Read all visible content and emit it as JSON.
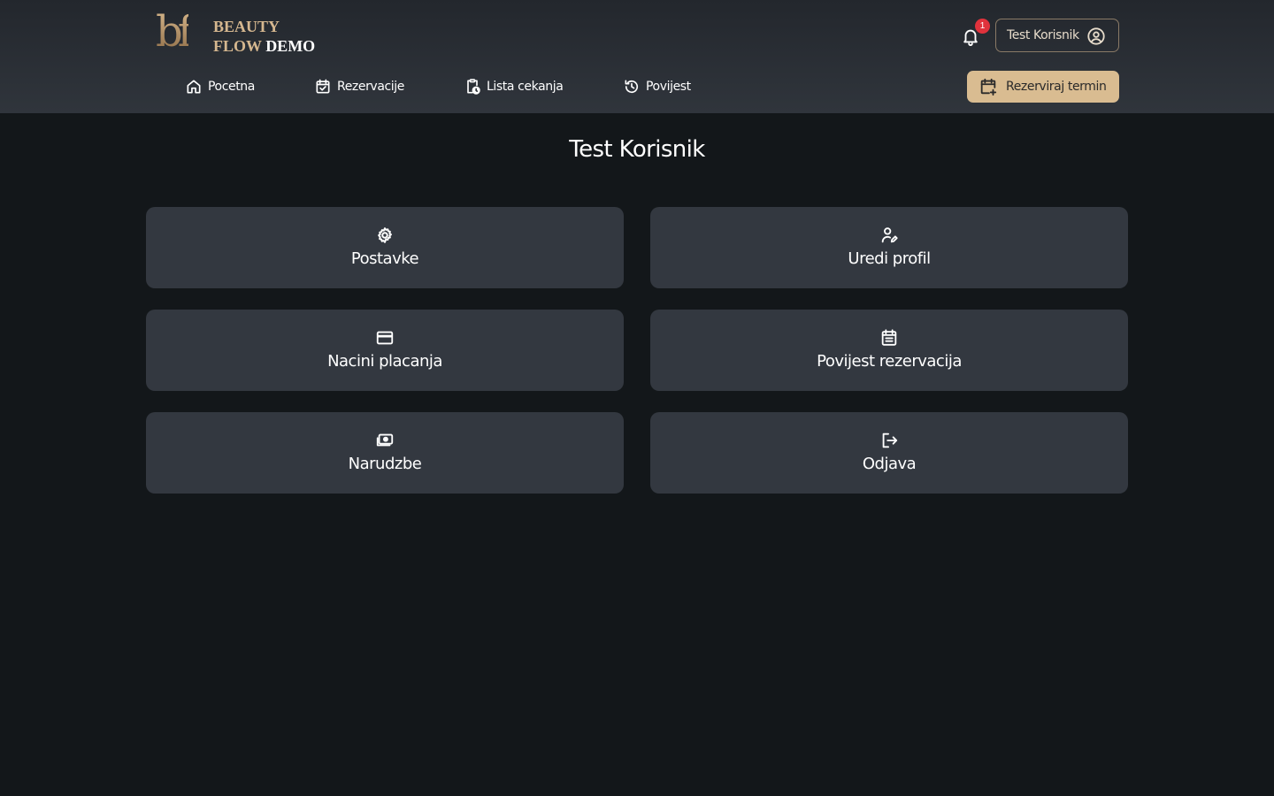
{
  "logo": {
    "mark": "bf",
    "line1": "BEAUTY",
    "line2": "FLOW",
    "line2_suffix": "DEMO"
  },
  "header": {
    "notification_count": "1",
    "user_name": "Test Korisnik",
    "book_button": "Rezerviraj termin"
  },
  "nav": {
    "items": [
      {
        "label": "Pocetna",
        "icon": "home-icon"
      },
      {
        "label": "Rezervacije",
        "icon": "calendar-check-icon"
      },
      {
        "label": "Lista cekanja",
        "icon": "clipboard-clock-icon"
      },
      {
        "label": "Povijest",
        "icon": "history-icon"
      }
    ]
  },
  "page": {
    "title": "Test Korisnik"
  },
  "cards": [
    {
      "label": "Postavke",
      "icon": "gear-icon"
    },
    {
      "label": "Uredi profil",
      "icon": "user-edit-icon"
    },
    {
      "label": "Nacini placanja",
      "icon": "credit-card-icon"
    },
    {
      "label": "Povijest rezervacija",
      "icon": "calendar-list-icon"
    },
    {
      "label": "Narudzbe",
      "icon": "cash-icon"
    },
    {
      "label": "Odjava",
      "icon": "logout-icon"
    }
  ],
  "colors": {
    "background": "#13171a",
    "header": "#2b3036",
    "card": "#333840",
    "accent": "#d9bc91",
    "badge": "#e0323c"
  }
}
